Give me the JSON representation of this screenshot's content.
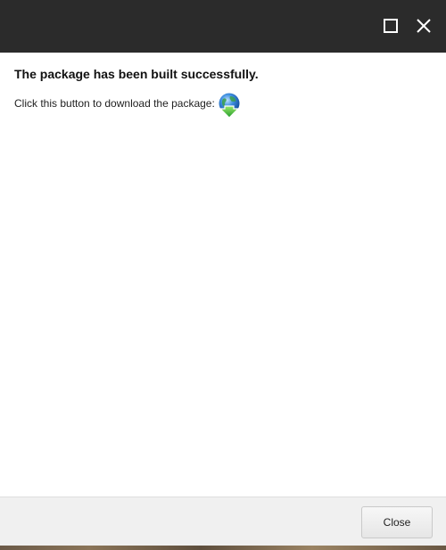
{
  "dialog": {
    "heading": "The package has been built successfully.",
    "download_prompt": "Click this button to download the package:",
    "download_icon": "globe-download-icon",
    "close_label": "Close"
  },
  "titlebar": {
    "maximize_icon": "maximize-icon",
    "close_icon": "close-icon"
  },
  "colors": {
    "titlebar_bg": "#2b2b2b",
    "footer_bg": "#f0f0f0",
    "globe_blue": "#1f6fc5",
    "arrow_green": "#3cb43c"
  }
}
